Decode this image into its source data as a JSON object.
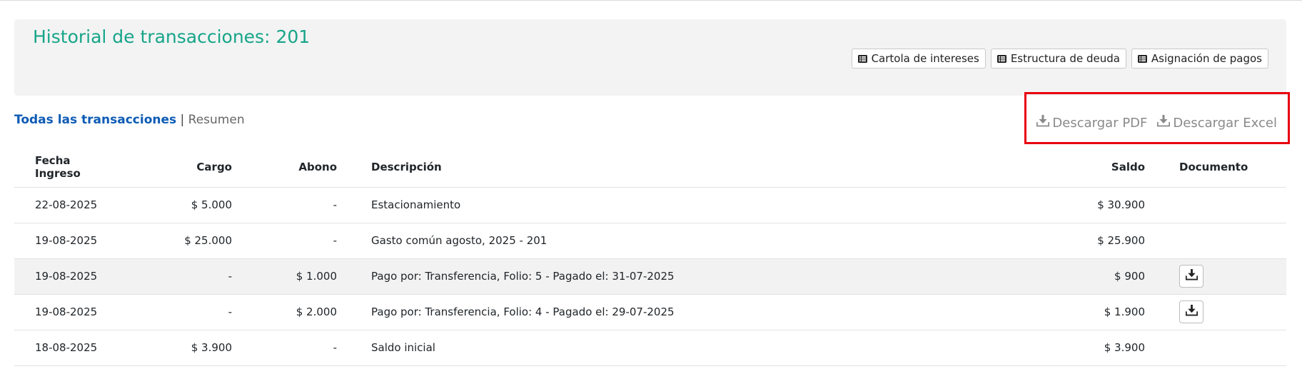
{
  "header": {
    "title": "Historial de transacciones: 201",
    "buttons": [
      {
        "label": "Cartola de intereses",
        "icon": "list-icon"
      },
      {
        "label": "Estructura de deuda",
        "icon": "list-icon"
      },
      {
        "label": "Asignación de pagos",
        "icon": "list-icon"
      }
    ]
  },
  "view_switch": {
    "active": "Todas las transacciones",
    "separator": " | ",
    "inactive": "Resumen"
  },
  "downloads": {
    "pdf_label": "Descargar PDF",
    "excel_label": "Descargar Excel",
    "icon": "download-icon"
  },
  "colors": {
    "title": "#17a589",
    "active_tab": "#0d5bb5",
    "highlight_border": "#e8000f"
  },
  "table": {
    "headers": {
      "fecha_line1": "Fecha",
      "fecha_line2": "Ingreso",
      "cargo": "Cargo",
      "abono": "Abono",
      "descripcion": "Descripción",
      "saldo": "Saldo",
      "documento": "Documento"
    },
    "rows": [
      {
        "fecha": "22-08-2025",
        "cargo": "$ 5.000",
        "abono": "-",
        "descripcion": "Estacionamiento",
        "saldo": "$ 30.900",
        "documento": false
      },
      {
        "fecha": "19-08-2025",
        "cargo": "$ 25.000",
        "abono": "-",
        "descripcion": "Gasto común agosto, 2025 - 201",
        "saldo": "$ 25.900",
        "documento": false
      },
      {
        "fecha": "19-08-2025",
        "cargo": "-",
        "abono": "$ 1.000",
        "descripcion": "Pago por: Transferencia, Folio: 5 - Pagado el: 31-07-2025",
        "saldo": "$ 900",
        "documento": true
      },
      {
        "fecha": "19-08-2025",
        "cargo": "-",
        "abono": "$ 2.000",
        "descripcion": "Pago por: Transferencia, Folio: 4 - Pagado el: 29-07-2025",
        "saldo": "$ 1.900",
        "documento": true
      },
      {
        "fecha": "18-08-2025",
        "cargo": "$ 3.900",
        "abono": "-",
        "descripcion": "Saldo inicial",
        "saldo": "$ 3.900",
        "documento": false
      }
    ]
  }
}
